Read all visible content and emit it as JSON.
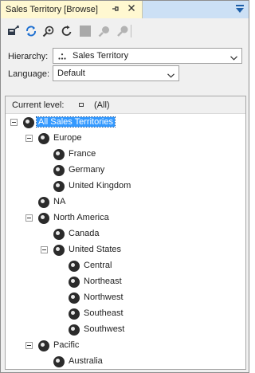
{
  "panel": {
    "tab_title": "Sales Territory [Browse]",
    "pin_icon": "pin-icon",
    "close_icon": "close-icon"
  },
  "toolbar": {
    "buttons": [
      {
        "icon": "process-icon",
        "enabled": true
      },
      {
        "icon": "reconnect-icon",
        "enabled": true
      },
      {
        "icon": "member-properties-icon",
        "enabled": true
      },
      {
        "icon": "refresh-icon",
        "enabled": true
      },
      {
        "icon": "stop-icon",
        "enabled": false
      },
      {
        "icon": "find-icon",
        "enabled": false
      },
      {
        "icon": "filter-icon",
        "enabled": false
      }
    ]
  },
  "hierarchy": {
    "label": "Hierarchy:",
    "value": "Sales Territory",
    "icon": "hierarchy-icon"
  },
  "language": {
    "label": "Language:",
    "value": "Default"
  },
  "tree": {
    "current_level_label": "Current level:",
    "current_level_value": "(All)",
    "nodes": [
      {
        "label": "All Sales Territories",
        "level": 0,
        "expander": true,
        "selected": true
      },
      {
        "label": "Europe",
        "level": 1,
        "expander": true,
        "selected": false
      },
      {
        "label": "France",
        "level": 2,
        "expander": false,
        "selected": false
      },
      {
        "label": "Germany",
        "level": 2,
        "expander": false,
        "selected": false
      },
      {
        "label": "United Kingdom",
        "level": 2,
        "expander": false,
        "selected": false
      },
      {
        "label": "NA",
        "level": 1,
        "expander": false,
        "selected": false
      },
      {
        "label": "North America",
        "level": 1,
        "expander": true,
        "selected": false
      },
      {
        "label": "Canada",
        "level": 2,
        "expander": false,
        "selected": false
      },
      {
        "label": "United States",
        "level": 2,
        "expander": true,
        "selected": false
      },
      {
        "label": "Central",
        "level": 3,
        "expander": false,
        "selected": false
      },
      {
        "label": "Northeast",
        "level": 3,
        "expander": false,
        "selected": false
      },
      {
        "label": "Northwest",
        "level": 3,
        "expander": false,
        "selected": false
      },
      {
        "label": "Southeast",
        "level": 3,
        "expander": false,
        "selected": false
      },
      {
        "label": "Southwest",
        "level": 3,
        "expander": false,
        "selected": false
      },
      {
        "label": "Pacific",
        "level": 1,
        "expander": true,
        "selected": false
      },
      {
        "label": "Australia",
        "level": 2,
        "expander": false,
        "selected": false
      }
    ]
  }
}
